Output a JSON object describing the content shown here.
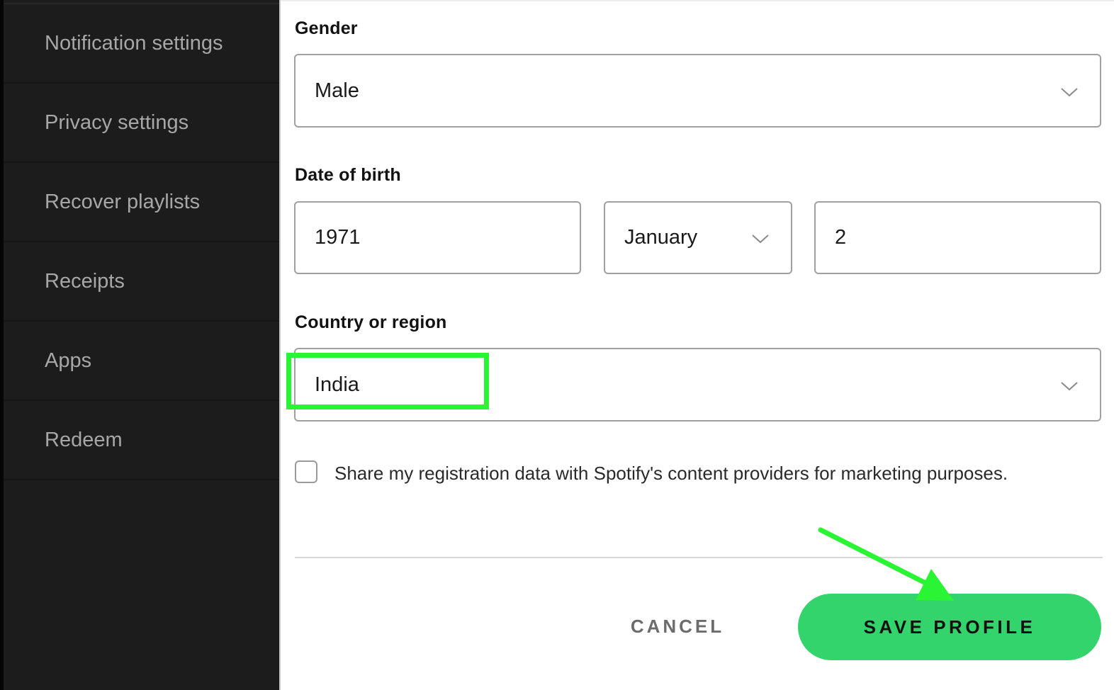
{
  "sidebar": {
    "items": [
      {
        "label": "Notification settings"
      },
      {
        "label": "Privacy settings"
      },
      {
        "label": "Recover playlists"
      },
      {
        "label": "Receipts"
      },
      {
        "label": "Apps"
      },
      {
        "label": "Redeem"
      }
    ]
  },
  "form": {
    "gender": {
      "label": "Gender",
      "value": "Male",
      "icon": "chevron-down-icon"
    },
    "date_of_birth": {
      "label": "Date of birth",
      "year": "1971",
      "month": "January",
      "day": "2",
      "month_icon": "chevron-down-icon"
    },
    "country": {
      "label": "Country or region",
      "value": "India",
      "icon": "chevron-down-icon"
    },
    "share_data": {
      "checked": false,
      "label": "Share my registration data with Spotify's content providers for marketing purposes."
    }
  },
  "actions": {
    "cancel_label": "CANCEL",
    "save_label": "SAVE PROFILE"
  },
  "annotations": {
    "highlight_color": "#2af534",
    "arrow_color": "#2af534"
  },
  "colors": {
    "sidebar_bg": "#1c1c1c",
    "sidebar_text": "#a7a7a7",
    "accent_green": "#33d46b"
  }
}
